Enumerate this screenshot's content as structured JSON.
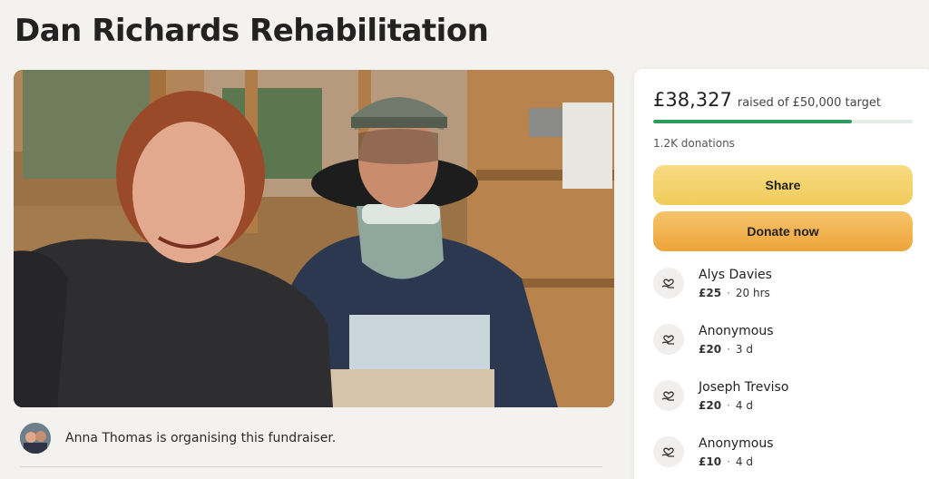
{
  "page": {
    "title": "Dan Richards Rehabilitation"
  },
  "organiser": {
    "text": "Anna Thomas is organising this fundraiser."
  },
  "panel": {
    "raised_amount": "£38,327",
    "raised_target": "raised of £50,000 target",
    "progress_fraction": 0.766,
    "donation_count": "1.2K donations",
    "share_label": "Share",
    "donate_label": "Donate now"
  },
  "donations": [
    {
      "name": "Alys Davies",
      "amount": "£25",
      "time": "20 hrs"
    },
    {
      "name": "Anonymous",
      "amount": "£20",
      "time": "3 d"
    },
    {
      "name": "Joseph Treviso",
      "amount": "£20",
      "time": "4 d"
    },
    {
      "name": "Anonymous",
      "amount": "£10",
      "time": "4 d"
    }
  ],
  "colors": {
    "progress": "#2f9a5e",
    "share_button": "#f1cb5a",
    "donate_button": "#eea43a"
  },
  "icons": {
    "donor": "heart-hand-icon"
  }
}
